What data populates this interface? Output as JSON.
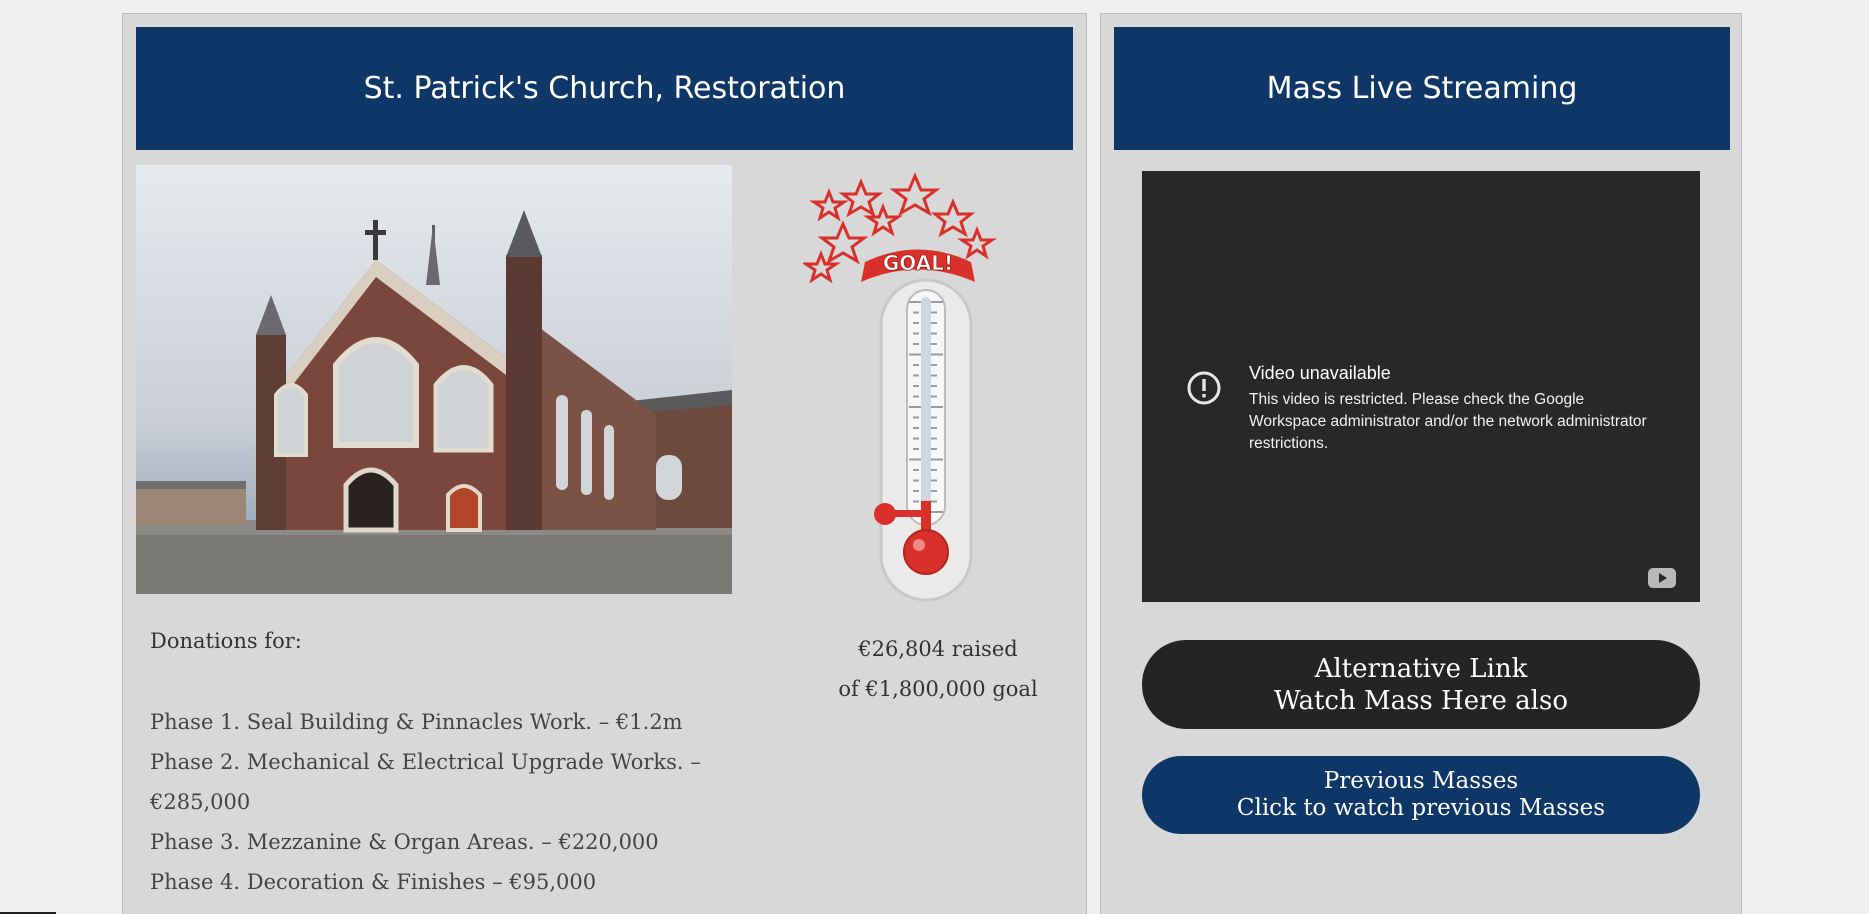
{
  "restoration": {
    "title": "St. Patrick's Church, Restoration",
    "donations_label": "Donations for:",
    "phases": [
      "Phase 1. Seal Building & Pinnacles Work. – €1.2m",
      "Phase 2. Mechanical & Electrical Upgrade Works. –",
      "€285,000",
      "Phase 3. Mezzanine & Organ Areas. – €220,000",
      "Phase 4. Decoration & Finishes – €95,000"
    ],
    "raised": "€26,804 raised",
    "goal": "of €1,800,000 goal",
    "goal_banner": "GOAL!",
    "progress_fraction": 0.0149
  },
  "streaming": {
    "title": "Mass Live Streaming",
    "video": {
      "title": "Video unavailable",
      "message": "This video is restricted. Please check the Google Workspace administrator and/or the network administrator restrictions."
    },
    "alt_link": {
      "line1": "Alternative Link",
      "line2": "Watch Mass Here also"
    },
    "previous": {
      "line1": "Previous Masses",
      "line2": "Click to watch previous Masses"
    }
  },
  "colors": {
    "header_blue": "#0e3767",
    "panel_bg": "#d8d8d8",
    "alt_button": "#262324",
    "thermo_red": "#d9302b"
  }
}
